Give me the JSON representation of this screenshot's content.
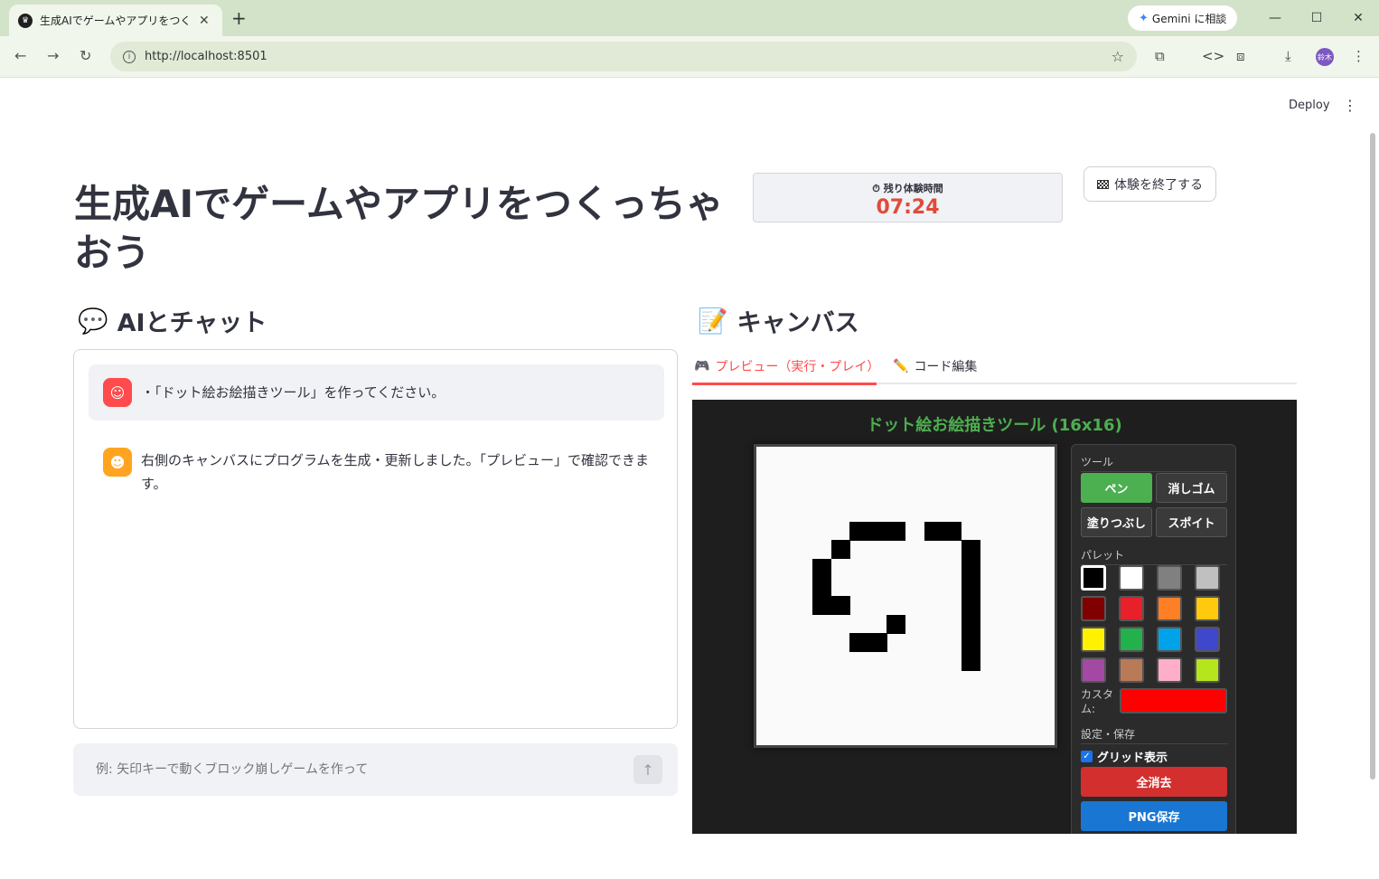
{
  "browser": {
    "tab_title": "生成AIでゲームやアプリをつくっちゃお",
    "tab_favicon": "crown-icon",
    "gemini_label": "Gemini に相談",
    "url": "http://localhost:8501",
    "avatar_text": "鈴木"
  },
  "header": {
    "deploy_label": "Deploy"
  },
  "page": {
    "title": "生成AIでゲームやアプリをつくっちゃおう",
    "timer_label": "残り体験時間",
    "timer_value": "07:24",
    "end_button_label": "体験を終了する"
  },
  "chat": {
    "heading_icon": "💬",
    "heading": "AIとチャット",
    "messages": [
      {
        "role": "user",
        "text": "・「ドット絵お絵描きツール」を作ってください。"
      },
      {
        "role": "assistant",
        "text": "右側のキャンバスにプログラムを生成・更新しました。「プレビュー」で確認できます。"
      }
    ],
    "input_placeholder": "例: 矢印キーで動くブロック崩しゲームを作って"
  },
  "canvas_section": {
    "heading_icon": "📝",
    "heading": "キャンバス",
    "tabs": [
      {
        "icon": "🎮",
        "label": "プレビュー（実行・プレイ）",
        "active": true
      },
      {
        "icon": "✏️",
        "label": "コード編集",
        "active": false
      }
    ]
  },
  "app": {
    "title": "ドット絵お絵描きツール (16x16)",
    "tools_label": "ツール",
    "tools": [
      "ペン",
      "消しゴム",
      "塗りつぶし",
      "スポイト"
    ],
    "active_tool": "ペン",
    "palette_label": "パレット",
    "palette": [
      "#000000",
      "#ffffff",
      "#808080",
      "#c0c0c0",
      "#800000",
      "#e8202a",
      "#ff7f27",
      "#ffc90e",
      "#fff200",
      "#22b14c",
      "#00a2e8",
      "#3f48cc",
      "#a349a4",
      "#b97a57",
      "#ffaec9",
      "#b5e61d"
    ],
    "selected_color": "#000000",
    "custom_label": "カスタム:",
    "custom_color": "#ff0000",
    "settings_label": "設定・保存",
    "grid_label": "グリッド表示",
    "grid_checked": true,
    "clear_label": "全消去",
    "save_label": "PNG保存",
    "pixels": [
      [
        5,
        4
      ],
      [
        6,
        4
      ],
      [
        7,
        4
      ],
      [
        9,
        4
      ],
      [
        10,
        4
      ],
      [
        4,
        5
      ],
      [
        11,
        5
      ],
      [
        3,
        6
      ],
      [
        11,
        6
      ],
      [
        3,
        7
      ],
      [
        11,
        7
      ],
      [
        3,
        8
      ],
      [
        4,
        8
      ],
      [
        11,
        8
      ],
      [
        7,
        9
      ],
      [
        11,
        9
      ],
      [
        5,
        10
      ],
      [
        6,
        10
      ],
      [
        11,
        10
      ],
      [
        11,
        11
      ]
    ]
  },
  "colors": {
    "accent": "#ff4b4b",
    "timer": "#e04b3a",
    "app_title": "#4caf50",
    "clear_button": "#d32f2f",
    "save_button": "#1976d2"
  }
}
